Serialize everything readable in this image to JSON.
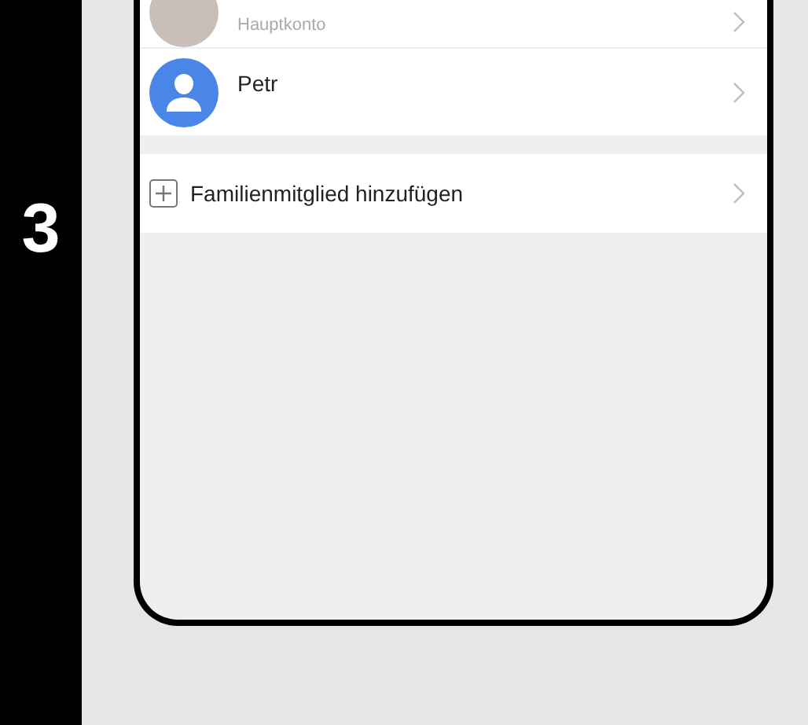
{
  "step": "3",
  "members": [
    {
      "subtitle": "Hauptkonto",
      "kind": "photo"
    },
    {
      "name": "Petr",
      "kind": "placeholder"
    }
  ],
  "add_member": {
    "label": "Familienmitglied hinzufügen"
  }
}
